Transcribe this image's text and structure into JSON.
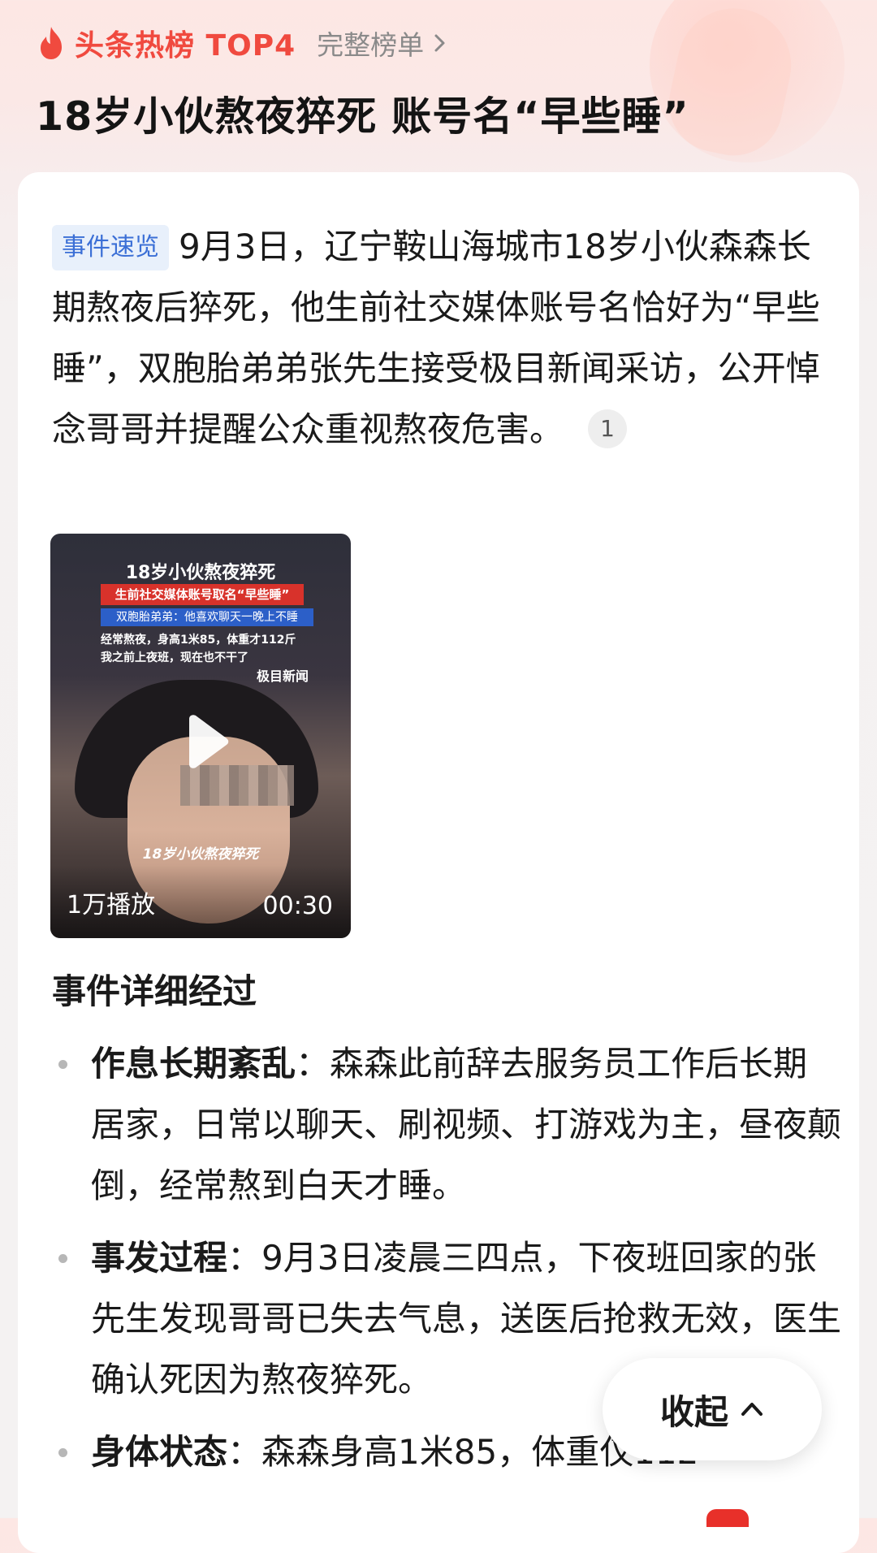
{
  "header": {
    "rank_label": "头条热榜 TOP4",
    "full_list_label": "完整榜单",
    "headline": "18岁小伙熬夜猝死 账号名“早些睡”"
  },
  "summary": {
    "tag": "事件速览",
    "text": "9月3日，辽宁鞍山海城市18岁小伙森森长期熬夜后猝死，他生前社交媒体账号名恰好为“早些睡”，双胞胎弟弟张先生接受极目新闻采访，公开悼念哥哥并提醒公众重视熬夜危害。",
    "citation": "1"
  },
  "video": {
    "overlay_title": "18岁小伙熬夜猝死",
    "overlay_red": "生前社交媒体账号取名“早些睡”",
    "overlay_blue": "双胞胎弟弟：他喜欢聊天一晚上不睡",
    "overlay_line1": "经常熬夜，身高1米85，体重才112斤",
    "overlay_line2": "我之前上夜班，现在也不干了",
    "overlay_brand": "极目新闻",
    "overlay_caption": "18岁小伙熬夜猝死",
    "play_count": "1万播放",
    "duration": "00:30"
  },
  "details": {
    "title": "事件详细经过",
    "items": [
      {
        "label": "作息长期紊乱",
        "sep": "：",
        "text": "森森此前辞去服务员工作后长期居家，日常以聊天、刷视频、打游戏为主，昼夜颠倒，经常熬到白天才睡。"
      },
      {
        "label": "事发过程",
        "sep": "：",
        "text": "9月3日凌晨三四点，下夜班回家的张先生发现哥哥已失去气息，送医后抢救无效，医生确认死因为熬夜猝死。"
      },
      {
        "label": "身体状态",
        "sep": "：",
        "text": "森森身高1米85，体重仅112"
      }
    ]
  },
  "collapse_label": "收起",
  "colors": {
    "accent_red": "#f04a3f",
    "tag_blue": "#3b6fd6",
    "tag_bg": "#e8f0fb"
  },
  "icons": [
    "flame-icon",
    "chevron-right-icon",
    "play-icon",
    "chevron-up-icon",
    "bullet-icon"
  ]
}
